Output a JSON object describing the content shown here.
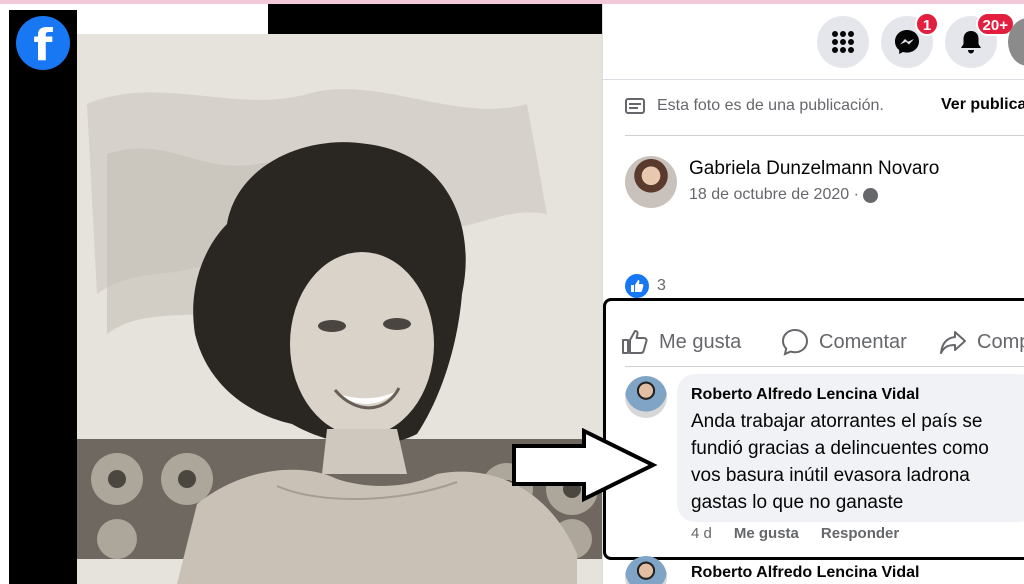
{
  "viewer": {
    "logo_letter": "f"
  },
  "topbar": {
    "messenger_badge": "1",
    "notifications_badge": "20+"
  },
  "notice": {
    "text": "Esta foto es de una publicación.",
    "link": "Ver publicación"
  },
  "post": {
    "author": "Gabriela Dunzelmann Novaro",
    "date": "18 de octubre de 2020 ·",
    "reaction_count": "3"
  },
  "actions": {
    "like": "Me gusta",
    "comment": "Comentar",
    "share": "Compartir"
  },
  "comments": [
    {
      "author": "Roberto Alfredo Lencina Vidal",
      "text": "Anda trabajar atorrantes el país se fundió gracias a delincuentes como vos basura inútil evasora ladrona gastas lo que no ganaste",
      "age": "4 d",
      "like": "Me gusta",
      "reply": "Responder"
    },
    {
      "author": "Roberto Alfredo Lencina Vidal"
    }
  ],
  "colors": {
    "brand": "#1877f2",
    "badge": "#e41e3f",
    "secondary_text": "#65676b"
  }
}
